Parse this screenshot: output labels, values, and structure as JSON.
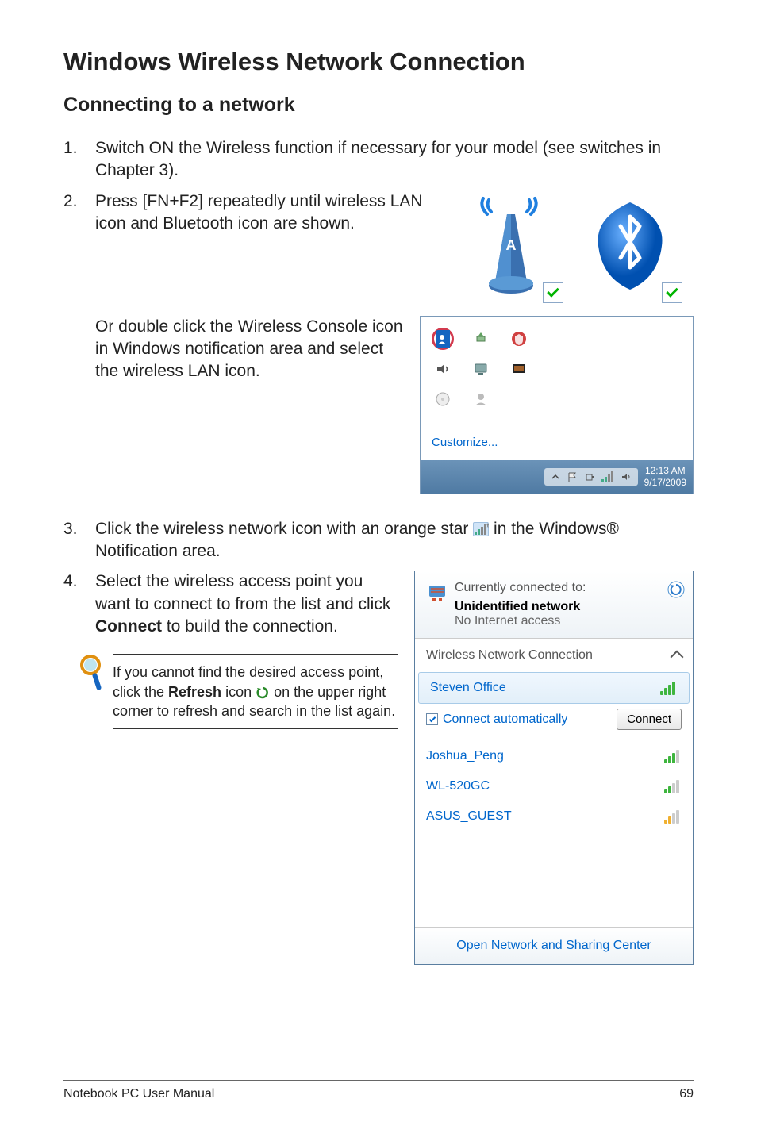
{
  "title": "Windows Wireless Network Connection",
  "subtitle": "Connecting to a network",
  "step1_num": "1.",
  "step1_text": "Switch ON the Wireless function if necessary for your model (see switches in Chapter 3).",
  "step2_num": "2.",
  "step2_text": "Press [FN+F2] repeatedly until wireless LAN icon and Bluetooth icon are shown.",
  "step2_alt": "Or double click the Wireless Console icon in Windows notification area and select the wireless LAN icon.",
  "tray": {
    "customize": "Customize...",
    "time": "12:13 AM",
    "date": "9/17/2009"
  },
  "step3_num": "3.",
  "step3_pre": "Click the wireless network icon with an orange star ",
  "step3_post": " in the Windows® Notification area.",
  "step4_num": "4.",
  "step4_pre": "Select the wireless access point you want to connect to from the list and click ",
  "step4_bold": "Connect",
  "step4_post": " to build the connection.",
  "tip_pre": "If you cannot find the desired access point, click the ",
  "tip_bold": "Refresh",
  "tip_mid": " icon ",
  "tip_post": " on the upper right corner to refresh and search in the list again.",
  "networks_panel": {
    "currently_connected": "Currently connected to:",
    "net_name": "Unidentified network",
    "net_sub": "No Internet access",
    "section_title": "Wireless Network Connection",
    "items": [
      {
        "name": "Steven Office",
        "selected": true
      },
      {
        "name": "Joshua_Peng"
      },
      {
        "name": "WL-520GC"
      },
      {
        "name": "ASUS_GUEST"
      }
    ],
    "auto_label": "Connect automatically",
    "connect_btn_underline": "C",
    "connect_btn_rest": "onnect",
    "footer": "Open Network and Sharing Center"
  },
  "page_footer_left": "Notebook PC User Manual",
  "page_footer_right": "69"
}
